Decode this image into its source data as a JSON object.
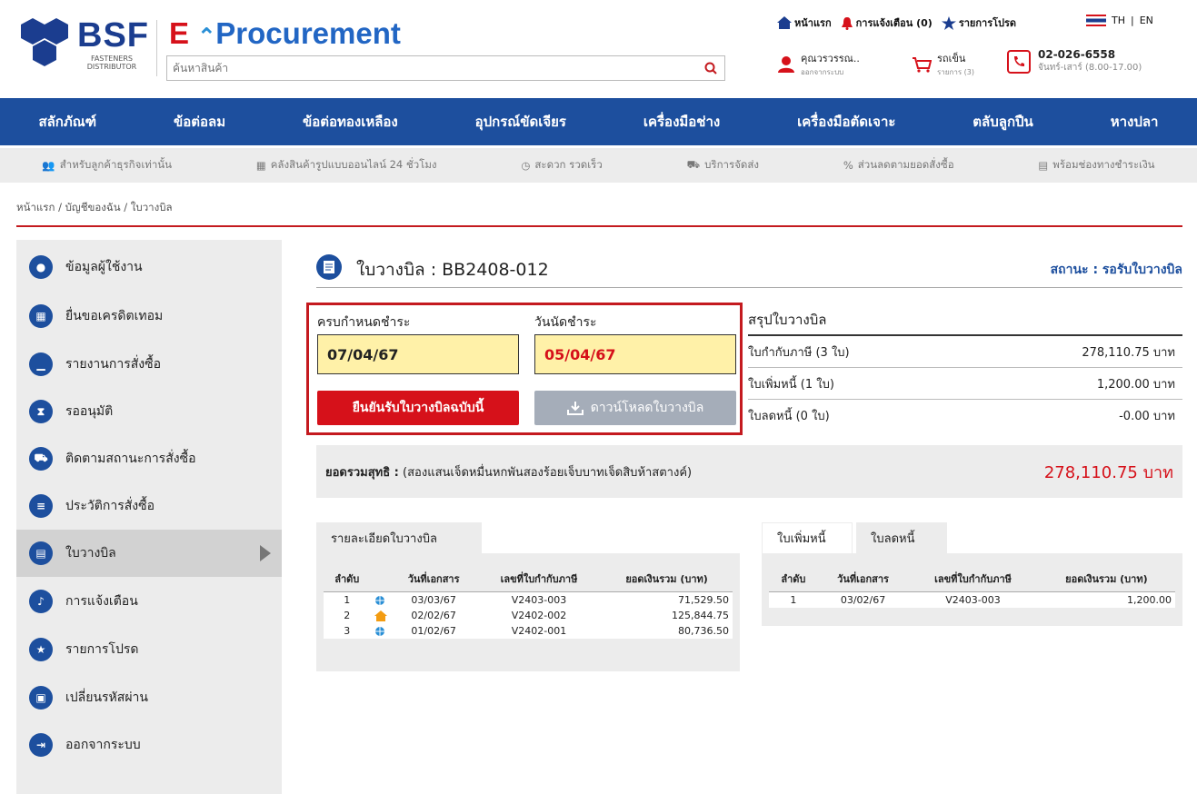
{
  "brand": {
    "logo": "BSF",
    "logo_sub_1": "FASTENERS",
    "logo_sub_2": "DISTRIBUTOR",
    "app_e": "E",
    "app_name": "Procurement"
  },
  "search": {
    "placeholder": "ค้นหาสินค้า"
  },
  "toplinks": {
    "home": "หน้าแรก",
    "notify": "การแจ้งเตือน (0)",
    "fav": "รายการโปรด"
  },
  "lang": {
    "th": "TH",
    "sep": "|",
    "en": "EN"
  },
  "user": {
    "name": "คุณวรวรรณ..",
    "sub": "ออกจากระบบ"
  },
  "cart": {
    "label": "รถเข็น",
    "sub": "รายการ (3)"
  },
  "contact": {
    "phone": "02-026-6558",
    "hours": "จันทร์-เสาร์ (8.00-17.00)"
  },
  "nav": [
    "สลักภัณฑ์",
    "ข้อต่อลม",
    "ข้อต่อทองเหลือง",
    "อุปกรณ์ขัดเจียร",
    "เครื่องมือช่าง",
    "เครื่องมือตัดเจาะ",
    "ตลับลูกปืน",
    "หางปลา"
  ],
  "subnav": [
    "สำหรับลูกค้าธุรกิจเท่านั้น",
    "คลังสินค้ารูปแบบออนไลน์ 24 ชั่วโมง",
    "สะดวก รวดเร็ว",
    "บริการจัดส่ง",
    "ส่วนลดตามยอดสั่งซื้อ",
    "พร้อมช่องทางชำระเงิน"
  ],
  "breadcrumb": "หน้าแรก / บัญชีของฉัน / ใบวางบิล",
  "sidebar": [
    "ข้อมูลผู้ใช้งาน",
    "ยื่นขอเครดิตเทอม",
    "รายงานการสั่งซื้อ",
    "รออนุมัติ",
    "ติดตามสถานะการสั่งซื้อ",
    "ประวัติการสั่งซื้อ",
    "ใบวางบิล",
    "การแจ้งเตือน",
    "รายการโปรด",
    "เปลี่ยนรหัสผ่าน",
    "ออกจากระบบ"
  ],
  "page": {
    "title": "ใบวางบิล : BB2408-012",
    "status": "สถานะ : รอรับใบวางบิล"
  },
  "due": {
    "due_label": "ครบกำหนดชำระ",
    "due_value": "07/04/67",
    "pay_label": "วันนัดชำระ",
    "pay_value": "05/04/67",
    "confirm_btn": "ยืนยันรับใบวางบิลฉบับนี้",
    "download_btn": "ดาวน์โหลดใบวางบิล"
  },
  "summary": {
    "title": "สรุปใบวางบิล",
    "rows": [
      {
        "label": "ใบกำกับภาษี (3 ใบ)",
        "value": "278,110.75 บาท"
      },
      {
        "label": "ใบเพิ่มหนี้ (1 ใบ)",
        "value": "1,200.00 บาท"
      },
      {
        "label": "ใบลดหนี้ (0 ใบ)",
        "value": "-0.00 บาท"
      }
    ]
  },
  "total": {
    "label": "ยอดรวมสุทธิ :",
    "words": "(สองแสนเจ็ดหมื่นหกพันสองร้อยเจ็บบาทเจ็ดสิบห้าสตางค์)",
    "amount": "278,110.75 บาท"
  },
  "detail": {
    "tab": "รายละเอียดใบวางบิล",
    "headers": [
      "ลำดับ",
      "",
      "วันที่เอกสาร",
      "เลขที่ใบกำกับภาษี",
      "ยอดเงินรวม (บาท)"
    ],
    "rows": [
      [
        "1",
        "globe",
        "03/03/67",
        "V2403-003",
        "71,529.50"
      ],
      [
        "2",
        "home",
        "02/02/67",
        "V2402-002",
        "125,844.75"
      ],
      [
        "3",
        "globe",
        "01/02/67",
        "V2402-001",
        "80,736.50"
      ]
    ]
  },
  "notes": {
    "tab_debit": "ใบเพิ่มหนี้",
    "tab_credit": "ใบลดหนี้",
    "headers": [
      "ลำดับ",
      "วันที่เอกสาร",
      "เลขที่ใบกำกับภาษี",
      "ยอดเงินรวม (บาท)"
    ],
    "rows": [
      [
        "1",
        "03/02/67",
        "V2403-003",
        "1,200.00"
      ]
    ]
  }
}
